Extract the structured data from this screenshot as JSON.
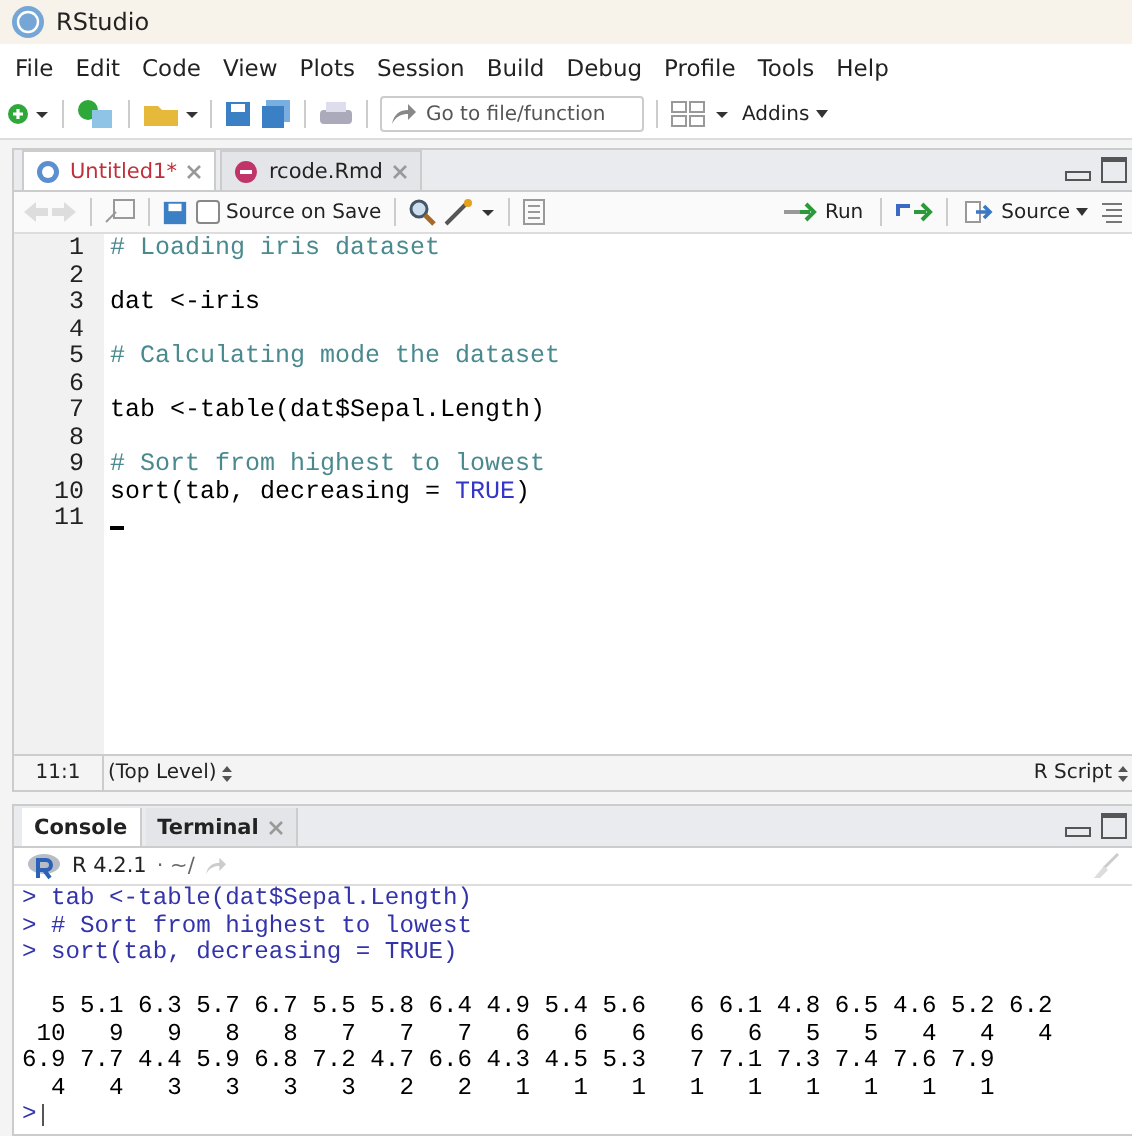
{
  "window": {
    "title": "RStudio"
  },
  "menu": [
    "File",
    "Edit",
    "Code",
    "View",
    "Plots",
    "Session",
    "Build",
    "Debug",
    "Profile",
    "Tools",
    "Help"
  ],
  "toolbar": {
    "goto_placeholder": "Go to file/function",
    "addins": "Addins"
  },
  "editor_tabs": [
    {
      "label": "Untitled1*",
      "selected": true,
      "kind": "r"
    },
    {
      "label": "rcode.Rmd",
      "selected": false,
      "kind": "rmd"
    }
  ],
  "editor_toolbar": {
    "source_on_save": {
      "label": "Source on Save",
      "checked": false
    },
    "run": "Run",
    "source": "Source"
  },
  "code_lines": [
    {
      "number": "1",
      "tokens": [
        {
          "text": "# Loading iris dataset",
          "kind": "comment"
        }
      ]
    },
    {
      "number": "2"
    },
    {
      "number": "3",
      "tokens": [
        {
          "text": "dat <-iris",
          "kind": "code"
        }
      ]
    },
    {
      "number": "4"
    },
    {
      "number": "5",
      "tokens": [
        {
          "text": "# Calculating mode the dataset",
          "kind": "comment"
        }
      ]
    },
    {
      "number": "6"
    },
    {
      "number": "7",
      "tokens": [
        {
          "text": "tab <-table(dat$Sepal.Length)",
          "kind": "code"
        }
      ]
    },
    {
      "number": "8"
    },
    {
      "number": "9",
      "tokens": [
        {
          "text": "# Sort from highest to lowest",
          "kind": "comment"
        }
      ]
    },
    {
      "number": "10",
      "tokens": [
        {
          "text": "sort(tab, decreasing = ",
          "kind": "code"
        },
        {
          "text": "TRUE",
          "kind": "constant"
        },
        {
          "text": ")",
          "kind": "code"
        }
      ]
    },
    {
      "number": "11"
    }
  ],
  "editor_status": {
    "position": "11:1",
    "scope": "(Top Level)",
    "file_type": "R Script"
  },
  "console_tabs": [
    {
      "label": "Console",
      "selected": true,
      "closable": false
    },
    {
      "label": "Terminal",
      "selected": false,
      "closable": true
    }
  ],
  "console_header": {
    "version": "R 4.2.1",
    "path": "· ~/"
  },
  "console_lines": [
    {
      "kind": "input",
      "text": "> tab <-table(dat$Sepal.Length)"
    },
    {
      "kind": "input",
      "text": "> # Sort from highest to lowest"
    },
    {
      "kind": "input",
      "text": "> sort(tab, decreasing = TRUE)"
    },
    {
      "kind": "output"
    },
    {
      "kind": "output",
      "text": "  5 5.1 6.3 5.7 6.7 5.5 5.8 6.4 4.9 5.4 5.6   6 6.1 4.8 6.5 4.6 5.2 6.2"
    },
    {
      "kind": "output",
      "text": " 10   9   9   8   8   7   7   7   6   6   6   6   6   5   5   4   4   4"
    },
    {
      "kind": "output",
      "text": "6.9 7.7 4.4 5.9 6.8 7.2 4.7 6.6 4.3 4.5 5.3   7 7.1 7.3 7.4 7.6 7.9"
    },
    {
      "kind": "output",
      "text": "  4   4   3   3   3   3   2   2   1   1   1   1   1   1   1   1   1"
    }
  ],
  "console_prompt": ">"
}
